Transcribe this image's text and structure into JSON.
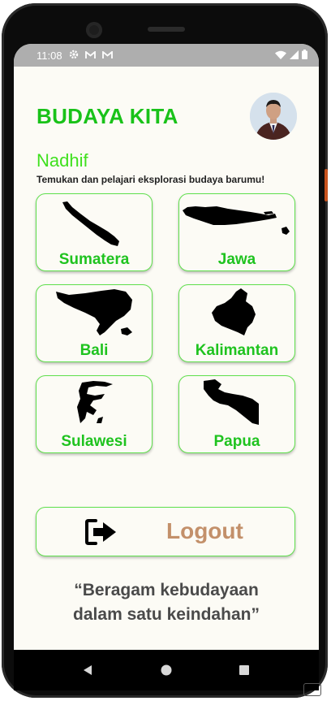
{
  "status_bar": {
    "time": "11:08"
  },
  "header": {
    "title": "BUDAYA KITA"
  },
  "user": {
    "name": "Nadhif"
  },
  "intro": {
    "text": "Temukan dan pelajari eksplorasi budaya barumu!"
  },
  "regions": [
    {
      "label": "Sumatera",
      "icon": "sumatera-map-icon"
    },
    {
      "label": "Jawa",
      "icon": "jawa-map-icon"
    },
    {
      "label": "Bali",
      "icon": "bali-map-icon"
    },
    {
      "label": "Kalimantan",
      "icon": "kalimantan-map-icon"
    },
    {
      "label": "Sulawesi",
      "icon": "sulawesi-map-icon"
    },
    {
      "label": "Papua",
      "icon": "papua-map-icon"
    }
  ],
  "logout": {
    "label": "Logout",
    "icon": "logout-icon"
  },
  "quote": {
    "line1": "“Beragam kebudayaan",
    "line2": "dalam satu keindahan”"
  },
  "colors": {
    "title_green": "#19c219",
    "name_green": "#3fe01e",
    "logout_text": "#c3906a",
    "background": "#fcfbf5"
  }
}
